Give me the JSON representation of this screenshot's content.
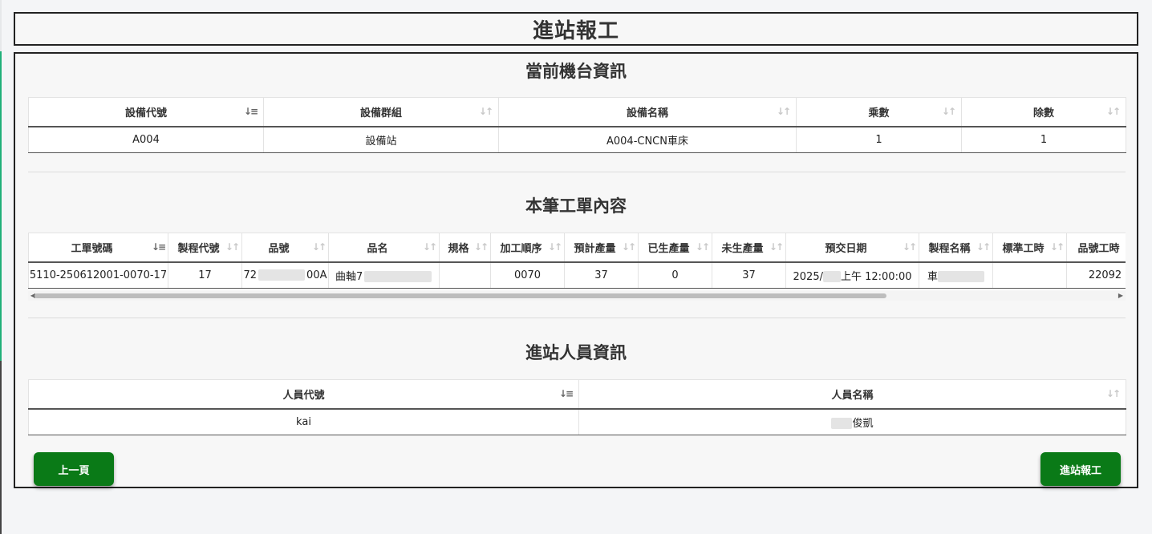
{
  "page": {
    "title": "進站報工"
  },
  "machine_section": {
    "title": "當前機台資訊",
    "columns": [
      "設備代號",
      "設備群組",
      "設備名稱",
      "乘數",
      "除數"
    ],
    "rows": [
      [
        "A004",
        "設備站",
        "A004-CNCN車床",
        "1",
        "1"
      ]
    ]
  },
  "work_order_section": {
    "title": "本筆工單內容",
    "columns": [
      "工單號碼",
      "製程代號",
      "品號",
      "品名",
      "規格",
      "加工順序",
      "預計產量",
      "已生產量",
      "未生產量",
      "預交日期",
      "製程名稱",
      "標準工時",
      "品號工時"
    ],
    "rows": [
      {
        "work_order_no": "5110-250612001-0070-17",
        "process_code": "17",
        "part_no_prefix": "72",
        "part_no_suffix": "00A",
        "part_name_prefix": "曲軸7",
        "spec": "",
        "sequence": "0070",
        "planned_qty": "37",
        "produced_qty": "0",
        "remaining_qty": "37",
        "due_prefix": "2025/",
        "due_suffix": "上午 12:00:00",
        "process_name_prefix": "車",
        "standard_hours": "",
        "part_hours": "22092"
      }
    ]
  },
  "staff_section": {
    "title": "進站人員資訊",
    "columns": [
      "人員代號",
      "人員名稱"
    ],
    "rows": [
      {
        "staff_code": "kai",
        "staff_name_suffix": "俊凱"
      }
    ]
  },
  "buttons": {
    "prev": "上一頁",
    "submit": "進站報工"
  },
  "icons": {
    "sort_neutral": "sort-arrows-icon",
    "sort_active": "sort-ascending-icon"
  },
  "colors": {
    "button_green": "#0a7a17",
    "accent_teal": "#20b07a"
  }
}
